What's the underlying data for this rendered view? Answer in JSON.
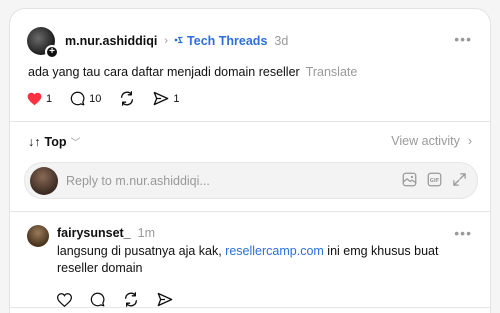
{
  "post": {
    "username": "m.nur.ashiddiqi",
    "topic": "Tech Threads",
    "time": "3d",
    "text": "ada yang tau cara daftar menjadi domain reseller",
    "translate_label": "Translate",
    "likes": "1",
    "replies": "10",
    "shares": "1",
    "like_color": "#ff3040"
  },
  "sort": {
    "label": "Top",
    "view_activity": "View activity"
  },
  "reply": {
    "placeholder": "Reply to m.nur.ashiddiqi..."
  },
  "comment": {
    "username": "fairysunset_",
    "time": "1m",
    "text_before": "langsung di pusatnya aja kak, ",
    "link": "resellercamp.com",
    "text_after": " ini emg khusus buat reseller domain"
  },
  "icons": {
    "topic": "topic-link-icon",
    "more": "more-dots-icon",
    "like": "heart-icon",
    "reply": "comment-bubble-icon",
    "repost": "repost-icon",
    "share": "send-icon",
    "gallery": "image-icon",
    "gif": "gif-icon",
    "expand": "expand-icon"
  },
  "colors": {
    "accent": "#2d6fdb",
    "muted": "#999999"
  }
}
